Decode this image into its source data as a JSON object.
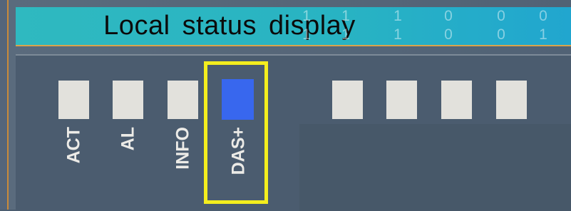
{
  "header": {
    "title": "Local status display"
  },
  "bit_columns": [
    {
      "top": "1",
      "bottom": "1"
    },
    {
      "top": "1",
      "bottom": "1"
    },
    {
      "top": "1",
      "bottom": "1"
    },
    {
      "top": "0",
      "bottom": "0"
    },
    {
      "top": "0",
      "bottom": "0"
    },
    {
      "top": "0",
      "bottom": "1"
    }
  ],
  "leds": [
    {
      "label": "ACT",
      "state": "off",
      "color": "#e2e1dc"
    },
    {
      "label": "AL",
      "state": "off",
      "color": "#e2e1dc"
    },
    {
      "label": "INFO",
      "state": "off",
      "color": "#e2e1dc"
    },
    {
      "label": "DAS+",
      "state": "on",
      "color": "#3867ee",
      "highlighted": true
    },
    {
      "label": "",
      "state": "off",
      "color": "#e2e1dc"
    },
    {
      "label": "",
      "state": "off",
      "color": "#e2e1dc"
    },
    {
      "label": "",
      "state": "off",
      "color": "#e2e1dc"
    },
    {
      "label": "",
      "state": "off",
      "color": "#e2e1dc"
    }
  ],
  "colors": {
    "highlight": "#f4ee1e",
    "header": "#2fb9c0",
    "panel": "#4b5c6f"
  }
}
